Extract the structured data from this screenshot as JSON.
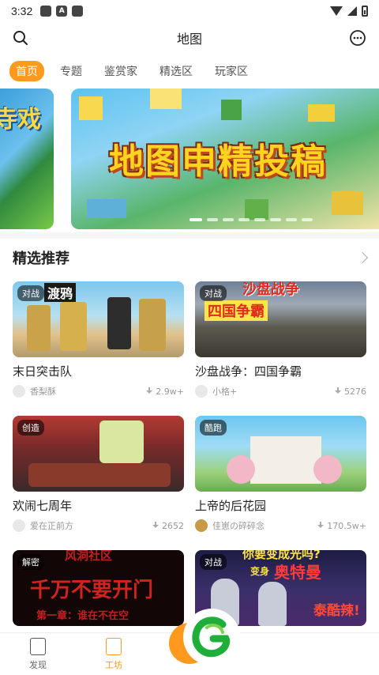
{
  "status_bar": {
    "time": "3:32"
  },
  "header": {
    "title": "地图"
  },
  "tabs": [
    {
      "label": "首页",
      "active": true
    },
    {
      "label": "专题",
      "active": false
    },
    {
      "label": "鉴赏家",
      "active": false
    },
    {
      "label": "精选区",
      "active": false
    },
    {
      "label": "玩家区",
      "active": false
    }
  ],
  "banner": {
    "prev_text": "寺戏",
    "main_text": "地图申精投稿",
    "dot_count": 8,
    "active_dot": 0
  },
  "section": {
    "title": "精选推荐"
  },
  "cards": [
    {
      "badge": "对战",
      "thumb_text": "渡鸦",
      "title": "末日突击队",
      "author": "香梨酥",
      "downloads": "2.9w+"
    },
    {
      "badge": "对战",
      "thumb_text": "四国争霸",
      "thumb_text_top": "沙盘战争",
      "title": "沙盘战争：四国争霸",
      "author": "小格+",
      "downloads": "5276"
    },
    {
      "badge": "创造",
      "thumb_text": "",
      "title": "欢闹七周年",
      "author": "爱在正前方",
      "downloads": "2652"
    },
    {
      "badge": "酷跑",
      "thumb_text": "",
      "title": "上帝的后花园",
      "author": "佳崽の碎碎念",
      "downloads": "170.5w+"
    },
    {
      "badge": "解密",
      "thumb_text": "千万不要开门",
      "thumb_text_top": "风洞社区",
      "thumb_text_bottom": "第一章：谁在不在空",
      "title": "",
      "author": "",
      "downloads": ""
    },
    {
      "badge": "对战",
      "thumb_text": "奥特曼",
      "thumb_text_top": "你要变成光吗?",
      "thumb_text_bottom": "泰酷辣!",
      "thumb_text_pre": "变身",
      "title": "",
      "author": "",
      "downloads": ""
    }
  ],
  "bottom_nav": [
    {
      "label": "发现",
      "active": false
    },
    {
      "label": "工坊",
      "active": true
    }
  ],
  "colors": {
    "accent": "#ff9a1f"
  }
}
